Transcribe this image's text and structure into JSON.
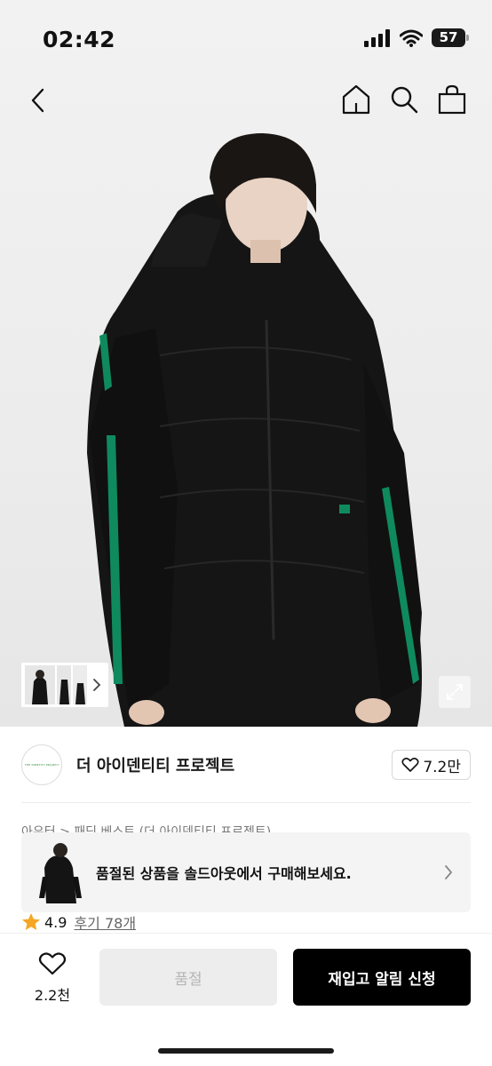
{
  "status_bar": {
    "time": "02:42",
    "battery": "57"
  },
  "nav": {
    "icons": [
      "chevron-left-icon",
      "home-icon",
      "search-icon",
      "shopping-bag-icon"
    ]
  },
  "gallery": {
    "thumbnail_count": 3
  },
  "brand": {
    "name": "더 아이덴티티 프로젝트",
    "like_count": "7.2만"
  },
  "breadcrumb": "아우터 > 패딩 베스트 (더 아이덴티티 프로젝트)",
  "soldout_banner": {
    "text": "품절된 상품을 솔드아웃에서 구매해보세요."
  },
  "rating": {
    "score": "4.9",
    "reviews": "후기 78개"
  },
  "bottom_bar": {
    "wish_count": "2.2천",
    "soldout_label": "품절",
    "restock_label": "재입고 알림 신청"
  },
  "colors": {
    "accent_green": "#0f8a5f",
    "primary_button": "#000000",
    "disabled_button": "#ededed"
  }
}
